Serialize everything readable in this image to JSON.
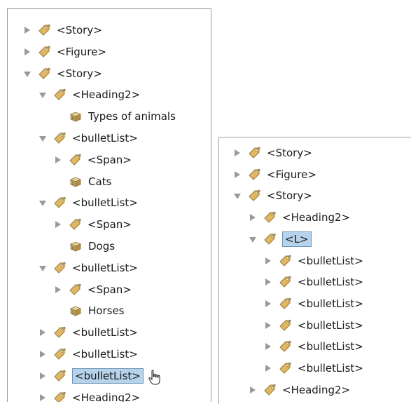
{
  "left_tree": {
    "nodes": [
      {
        "label": "<Story>",
        "type": "element",
        "arrow": "collapsed"
      },
      {
        "label": "<Figure>",
        "type": "element",
        "arrow": "collapsed"
      },
      {
        "label": "<Story>",
        "type": "element",
        "arrow": "expanded"
      },
      {
        "label": "<Heading2>",
        "type": "element",
        "arrow": "expanded"
      },
      {
        "label": "Types of animals",
        "type": "content",
        "arrow": "none"
      },
      {
        "label": "<bulletList>",
        "type": "element",
        "arrow": "expanded"
      },
      {
        "label": "<Span>",
        "type": "element",
        "arrow": "collapsed"
      },
      {
        "label": "Cats",
        "type": "content",
        "arrow": "none"
      },
      {
        "label": "<bulletList>",
        "type": "element",
        "arrow": "expanded"
      },
      {
        "label": "<Span>",
        "type": "element",
        "arrow": "collapsed"
      },
      {
        "label": "Dogs",
        "type": "content",
        "arrow": "none"
      },
      {
        "label": "<bulletList>",
        "type": "element",
        "arrow": "expanded"
      },
      {
        "label": "<Span>",
        "type": "element",
        "arrow": "collapsed"
      },
      {
        "label": "Horses",
        "type": "content",
        "arrow": "none"
      },
      {
        "label": "<bulletList>",
        "type": "element",
        "arrow": "collapsed"
      },
      {
        "label": "<bulletList>",
        "type": "element",
        "arrow": "collapsed"
      },
      {
        "label": "<bulletList>",
        "type": "element",
        "arrow": "collapsed",
        "selected": true
      },
      {
        "label": "<Heading2>",
        "type": "element",
        "arrow": "collapsed"
      }
    ]
  },
  "right_tree": {
    "nodes": [
      {
        "label": "<Story>",
        "type": "element",
        "arrow": "collapsed"
      },
      {
        "label": "<Figure>",
        "type": "element",
        "arrow": "collapsed"
      },
      {
        "label": "<Story>",
        "type": "element",
        "arrow": "expanded"
      },
      {
        "label": "<Heading2>",
        "type": "element",
        "arrow": "collapsed"
      },
      {
        "label": "<L>",
        "type": "element",
        "arrow": "expanded",
        "selected": true
      },
      {
        "label": "<bulletList>",
        "type": "element",
        "arrow": "collapsed"
      },
      {
        "label": "<bulletList>",
        "type": "element",
        "arrow": "collapsed"
      },
      {
        "label": "<bulletList>",
        "type": "element",
        "arrow": "collapsed"
      },
      {
        "label": "<bulletList>",
        "type": "element",
        "arrow": "collapsed"
      },
      {
        "label": "<bulletList>",
        "type": "element",
        "arrow": "collapsed"
      },
      {
        "label": "<bulletList>",
        "type": "element",
        "arrow": "collapsed"
      },
      {
        "label": "<Heading2>",
        "type": "element",
        "arrow": "collapsed"
      }
    ]
  },
  "colors": {
    "tag_fill": "#e0b765",
    "tag_stroke": "#9b7a35",
    "selection": "#b7d3ec",
    "arrow": "#9a9a9a"
  },
  "icons": {
    "element": "tag-icon",
    "content": "text-frame-icon",
    "cursor": "hand-cursor-icon"
  }
}
